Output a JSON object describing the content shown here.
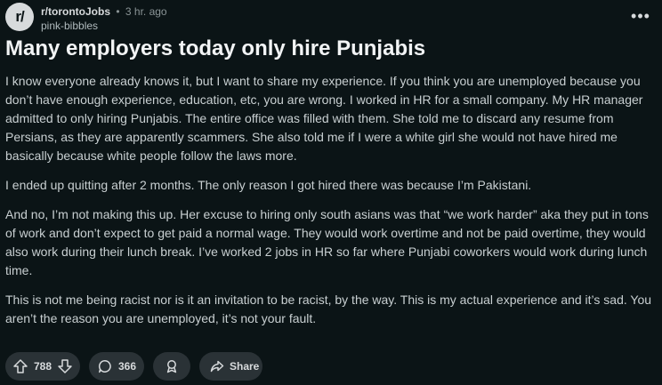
{
  "post": {
    "subreddit_icon": "r/",
    "subreddit": "r/torontoJobs",
    "separator": "•",
    "time": "3 hr. ago",
    "author": "pink-bibbles",
    "more_icon": "•••",
    "title": "Many employers today only hire Punjabis",
    "paragraphs": [
      "I know everyone already knows it, but I want to share my experience. If you think you are unemployed because you don’t have enough experience, education, etc, you are wrong. I worked in HR for a small company. My HR manager admitted to only hiring Punjabis. The entire office was filled with them. She told me to discard any resume from Persians, as they are apparently scammers. She also told me if I were a white girl she would not have hired me basically because white people follow the laws more.",
      "I ended up quitting after 2 months. The only reason I got hired there was because I’m Pakistani.",
      "And no, I’m not making this up. Her excuse to hiring only south asians was that “we work harder” aka they put in tons of work and don’t expect to get paid a normal wage. They would work overtime and not be paid overtime, they would also work during their lunch break. I’ve worked 2 jobs in HR so far where Punjabi coworkers would work during lunch time.",
      "This is not me being racist nor is it an invitation to be racist, by the way. This is my actual experience and it’s sad. You aren’t the reason you are unemployed, it’s not your fault."
    ]
  },
  "actions": {
    "votes": "788",
    "comments": "366",
    "share_label": "Share"
  },
  "icons": {
    "upvote": "upvote-arrow-icon",
    "downvote": "downvote-arrow-icon",
    "comment": "comment-bubble-icon",
    "award": "award-icon",
    "share": "share-arrow-icon"
  },
  "colors": {
    "background": "#0b1416",
    "pill": "#2a3236",
    "text": "#d7dadc",
    "muted": "#8a9496"
  }
}
